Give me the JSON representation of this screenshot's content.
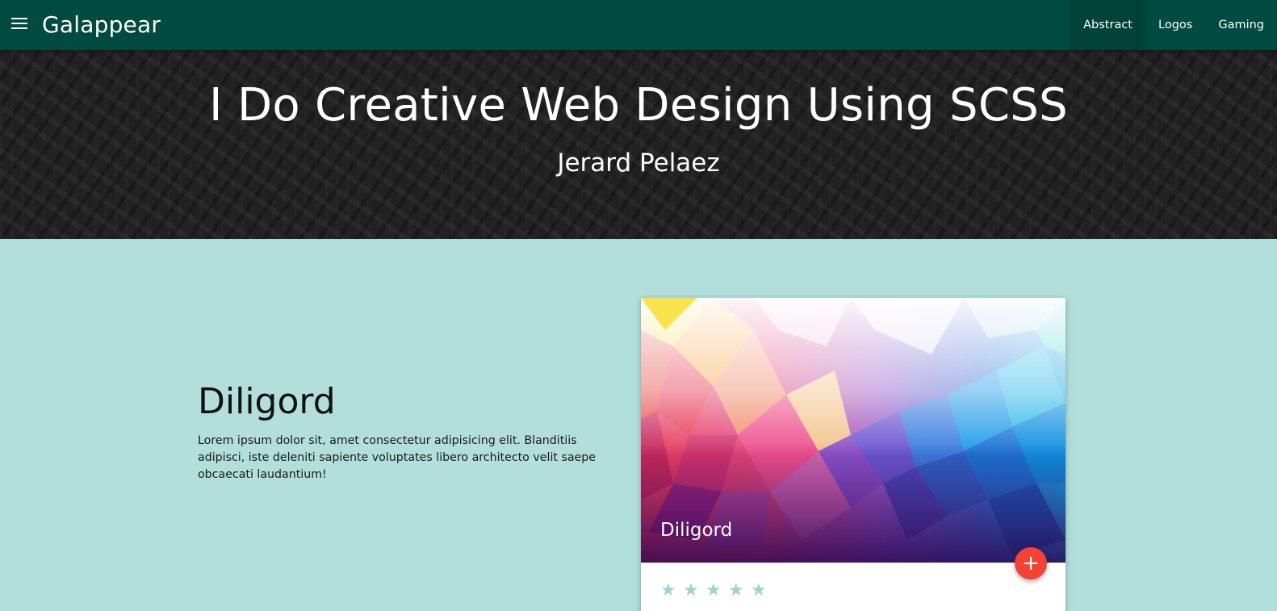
{
  "navbar": {
    "brand": "Galappear",
    "links": [
      {
        "label": "Abstract"
      },
      {
        "label": "Logos"
      },
      {
        "label": "Gaming"
      }
    ]
  },
  "hero": {
    "title": "I Do Creative Web Design Using SCSS",
    "subtitle": "Jerard Pelaez"
  },
  "section": {
    "title": "Diligord",
    "text": "Lorem ipsum dolor sit, amet consectetur adipisicing elit. Blanditiis adipisci, iste deleniti sapiente voluptates libero architecto velit saepe obcaecati laudantium!"
  },
  "card": {
    "title": "Diligord",
    "fab_label": "+",
    "rating": {
      "value": 0,
      "max": 5,
      "star_glyph": "★"
    }
  },
  "icons": {
    "menu": "menu-icon",
    "add": "plus-icon",
    "star": "star-icon"
  },
  "colors": {
    "navbar": "#004a3f",
    "background": "#b2dfdb",
    "hero": "#212121",
    "fab": "#f44336",
    "star": "#9fd3d0"
  }
}
